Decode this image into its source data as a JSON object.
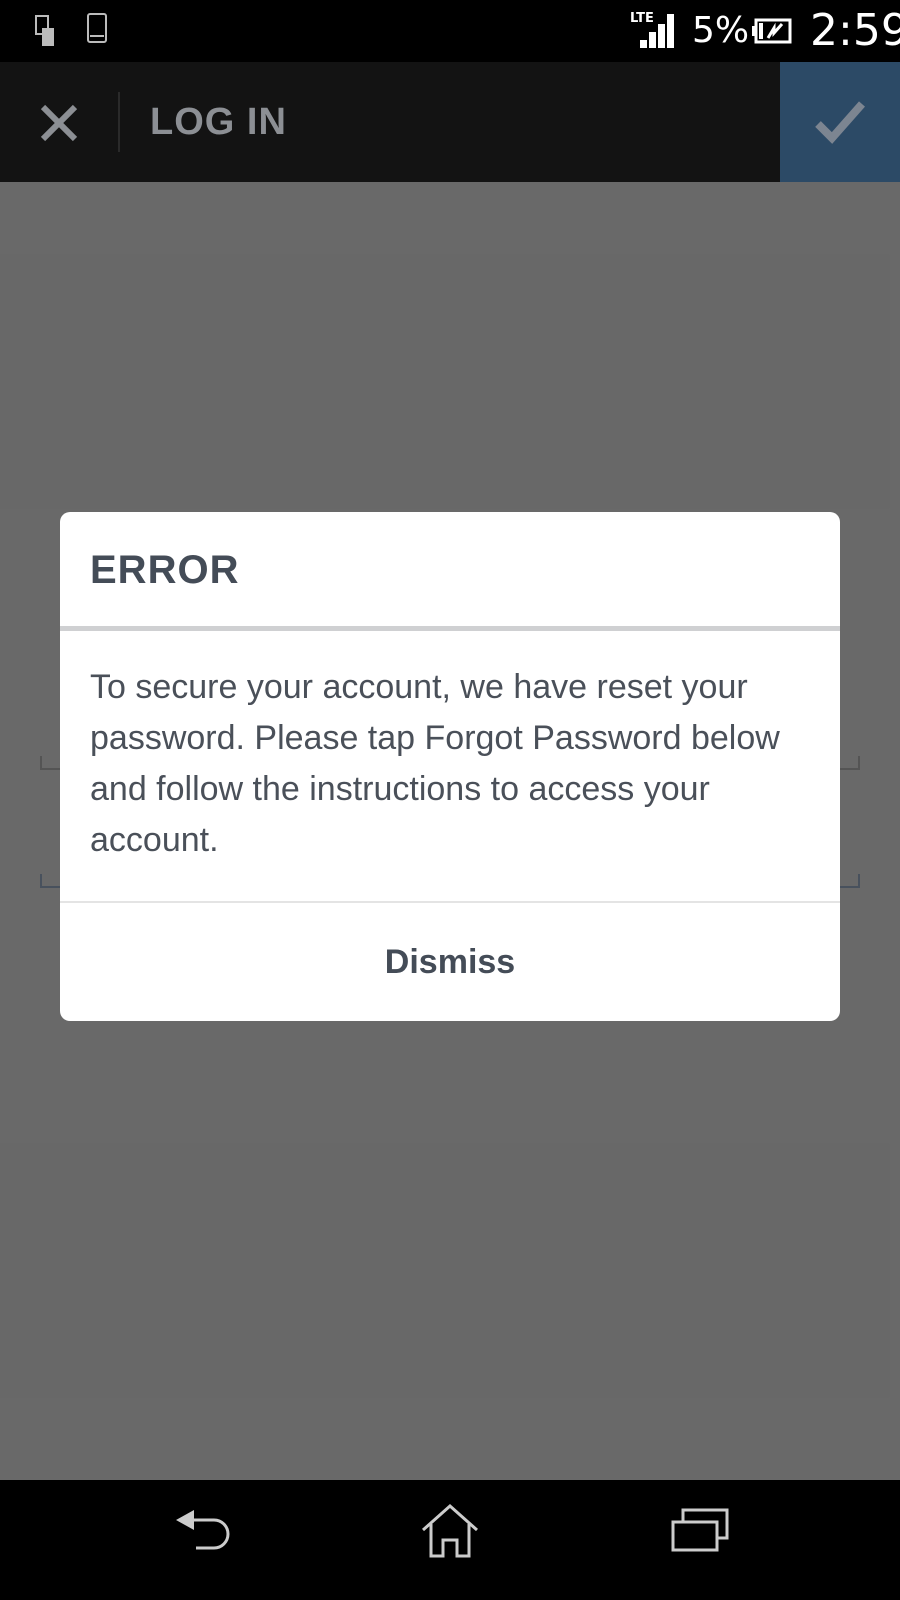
{
  "status_bar": {
    "network": "LTE",
    "battery_percent": "5%",
    "time": "2:59",
    "icons": [
      "sd-card-icon",
      "phone-icon",
      "lte-signal-icon",
      "battery-charging-icon"
    ]
  },
  "app_bar": {
    "title": "LOG IN",
    "close_icon": "close-icon",
    "confirm_icon": "checkmark-icon",
    "confirm_color": "#2c4a66"
  },
  "dialog": {
    "title": "ERROR",
    "message": "To secure your account, we have reset your password. Please tap Forgot Password below and follow the instructions to access your account.",
    "dismiss_label": "Dismiss"
  },
  "nav_bar": {
    "icons": [
      "back-icon",
      "home-icon",
      "recent-apps-icon"
    ]
  }
}
